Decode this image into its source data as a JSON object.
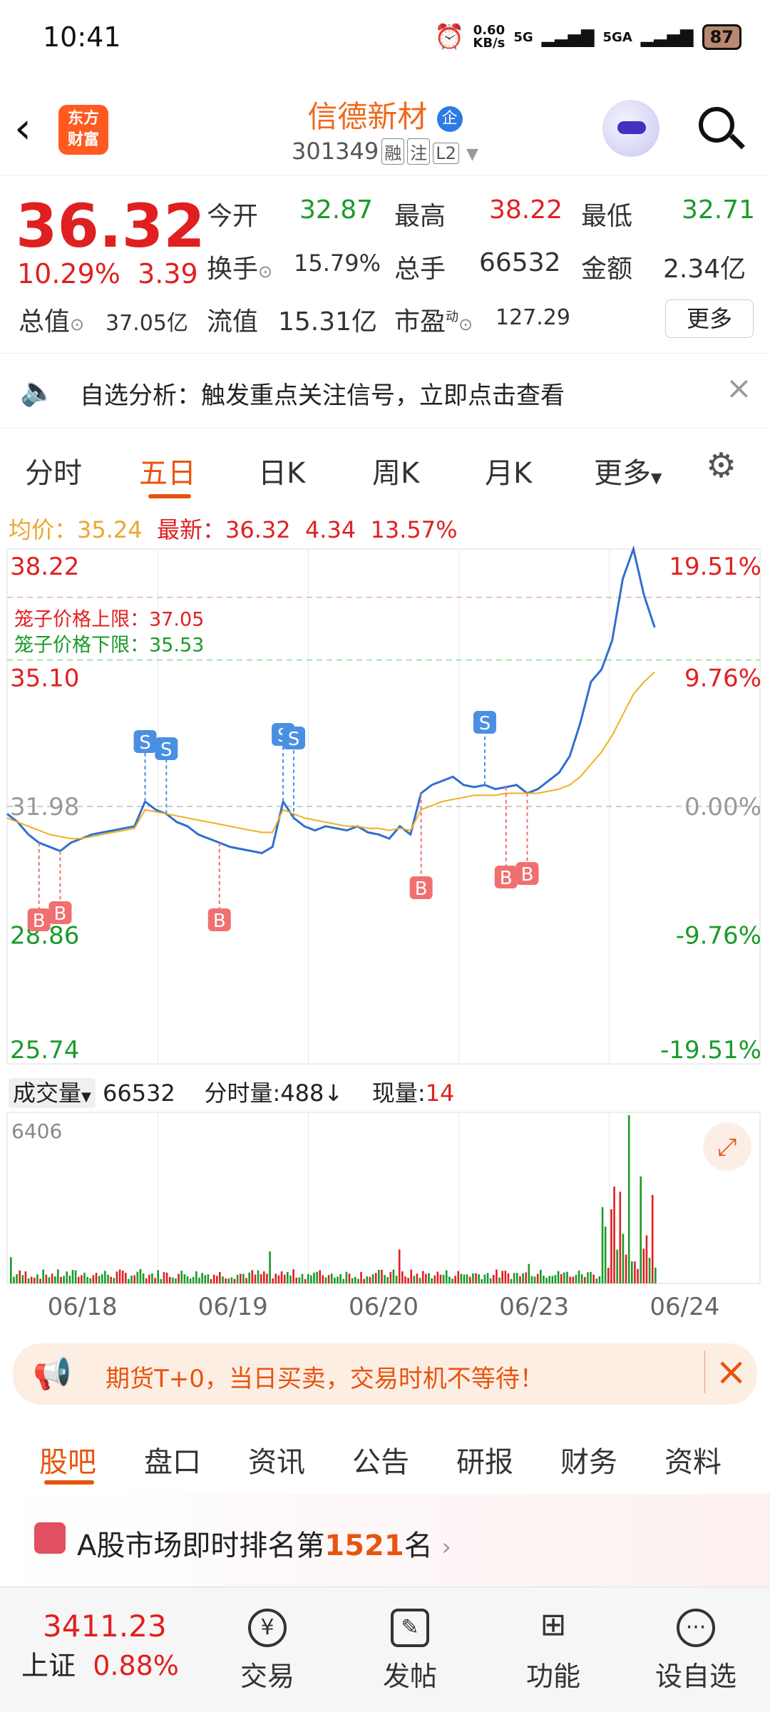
{
  "status_bar": {
    "time": "10:41",
    "net_speed": "0.60",
    "net_unit": "KB/s",
    "net1": "5G",
    "net2": "5GA",
    "battery": "87"
  },
  "header": {
    "logo_line1": "东方",
    "logo_line2": "财富",
    "stock_name": "信德新材",
    "badge": "企",
    "stock_code": "301349",
    "tags": [
      "融",
      "注",
      "L2"
    ]
  },
  "quote": {
    "price": "36.32",
    "change_pct": "10.29%",
    "change_amt": "3.39",
    "open_label": "今开",
    "open": "32.87",
    "high_label": "最高",
    "high": "38.22",
    "low_label": "最低",
    "low": "32.71",
    "turnover_label": "换手",
    "turnover": "15.79%",
    "volume_label": "总手",
    "volume": "66532",
    "amount_label": "金额",
    "amount": "2.34亿",
    "mktcap_label": "总值",
    "mktcap": "37.05亿",
    "float_label": "流值",
    "float": "15.31亿",
    "pe_label": "市盈",
    "pe_sup": "动",
    "pe": "127.29",
    "more": "更多"
  },
  "alert": {
    "text": "自选分析：触发重点关注信号，立即点击查看"
  },
  "tabs": [
    "分时",
    "五日",
    "日K",
    "周K",
    "月K",
    "更多"
  ],
  "chart_info": {
    "avg_label": "均价：",
    "avg": "35.24",
    "last_label": "最新：",
    "last": "36.32",
    "chg": "4.34",
    "pct": "13.57%"
  },
  "chart_data": {
    "type": "line",
    "x_labels": [
      "06/18",
      "06/19",
      "06/20",
      "06/23",
      "06/24"
    ],
    "y_left": [
      "38.22",
      "35.10",
      "31.98",
      "28.86",
      "25.74"
    ],
    "y_right": [
      "19.51%",
      "9.76%",
      "0.00%",
      "-9.76%",
      "-19.51%"
    ],
    "cage_upper_label": "笼子价格上限：",
    "cage_upper": "37.05",
    "cage_lower_label": "笼子价格下限：",
    "cage_lower": "35.53",
    "ylim": [
      25.74,
      38.22
    ],
    "series": [
      {
        "values": [
          31.8,
          31.6,
          31.3,
          31.1,
          31.0,
          30.9,
          31.1,
          31.2,
          31.3,
          31.35,
          31.4,
          31.45,
          31.5,
          32.1,
          31.9,
          31.8,
          31.6,
          31.5,
          31.3,
          31.2,
          31.1,
          31.0,
          30.95,
          30.9,
          30.85,
          31.0,
          32.1,
          31.7,
          31.5,
          31.4,
          31.5,
          31.45,
          31.4,
          31.5,
          31.35,
          31.3,
          31.2,
          31.5,
          31.3,
          32.3,
          32.5,
          32.6,
          32.7,
          32.5,
          32.45,
          32.5,
          32.4,
          32.45,
          32.5,
          32.3,
          32.4,
          32.6,
          32.8,
          33.2,
          34.0,
          35.0,
          35.3,
          36.0,
          37.5,
          38.22,
          37.1,
          36.32
        ]
      },
      {
        "values": [
          31.7,
          31.6,
          31.5,
          31.4,
          31.3,
          31.25,
          31.2,
          31.2,
          31.25,
          31.3,
          31.35,
          31.4,
          31.45,
          31.9,
          31.85,
          31.8,
          31.75,
          31.7,
          31.65,
          31.6,
          31.55,
          31.5,
          31.45,
          31.4,
          31.35,
          31.35,
          31.9,
          31.8,
          31.7,
          31.65,
          31.6,
          31.55,
          31.5,
          31.5,
          31.45,
          31.45,
          31.4,
          31.45,
          31.4,
          31.9,
          32.0,
          32.1,
          32.15,
          32.2,
          32.25,
          32.25,
          32.25,
          32.3,
          32.3,
          32.3,
          32.3,
          32.35,
          32.4,
          32.5,
          32.7,
          33.0,
          33.3,
          33.7,
          34.2,
          34.7,
          35.0,
          35.24
        ]
      }
    ],
    "volume": {
      "label": "成交量",
      "total": "66532",
      "tick_label": "分时量:488",
      "now_label": "现量:",
      "now": "14",
      "max": "6406"
    }
  },
  "promo": {
    "text": "期货T+0，当日买卖，交易时机不等待！"
  },
  "subtabs": [
    "股吧",
    "盘口",
    "资讯",
    "公告",
    "研报",
    "财务",
    "资料"
  ],
  "rank": {
    "prefix": "A股市场即时排名第",
    "num": "1521",
    "suffix": "名"
  },
  "bottom_nav": {
    "index_value": "3411.23",
    "index_name": "上证",
    "index_pct": "0.88%",
    "items": [
      "交易",
      "发帖",
      "功能",
      "设自选"
    ]
  }
}
